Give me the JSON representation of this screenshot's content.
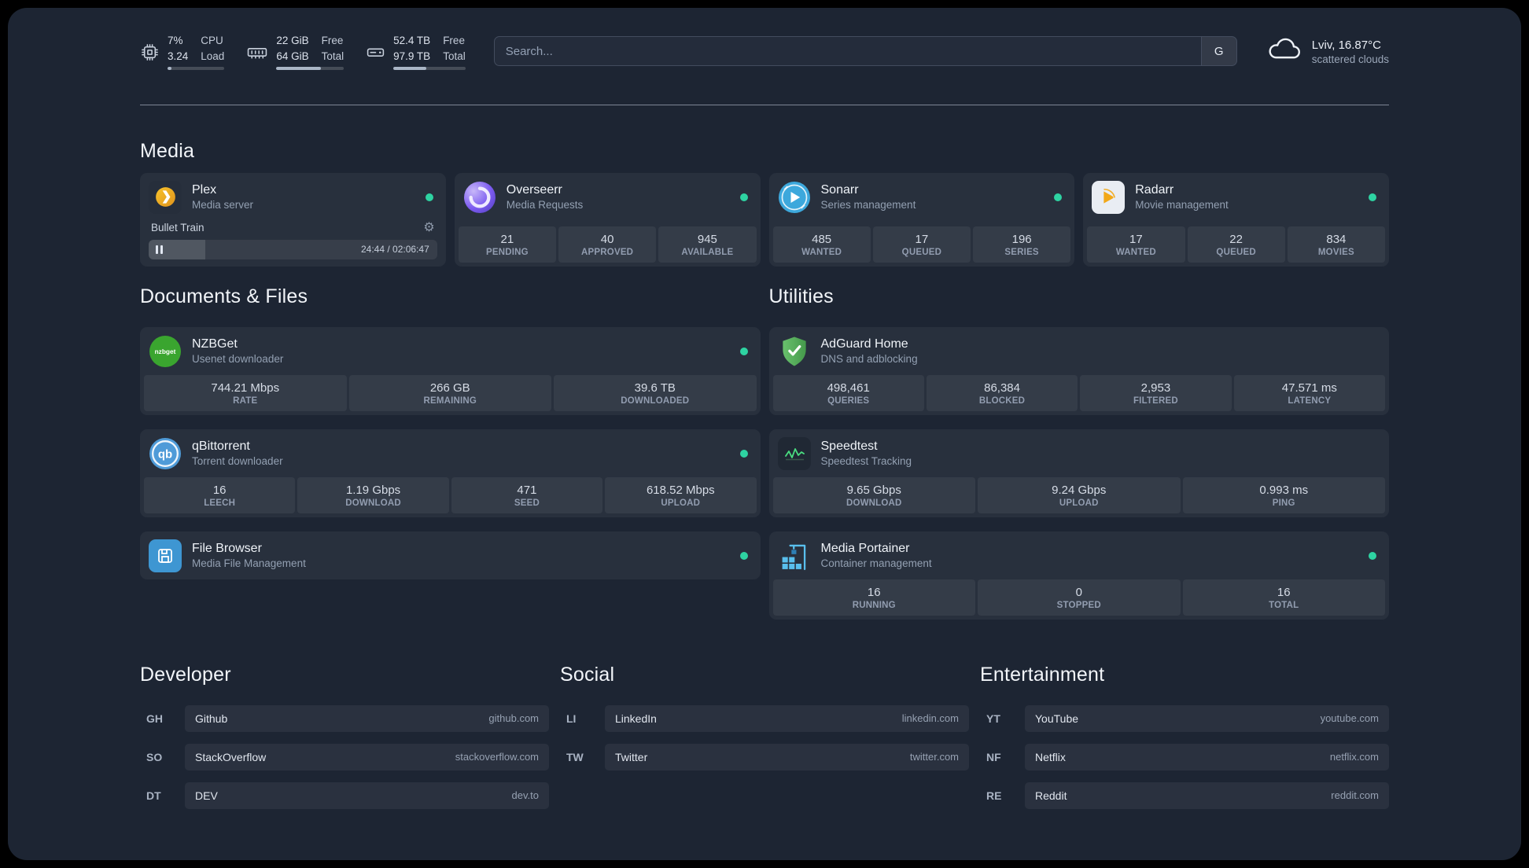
{
  "topbar": {
    "resources": [
      {
        "widget": "cpu",
        "value_top": "7%",
        "value_bottom": "3.24",
        "label_top": "CPU",
        "label_bottom": "Load",
        "percent": 7
      },
      {
        "widget": "memory",
        "value_top": "22 GiB",
        "value_bottom": "64 GiB",
        "label_top": "Free",
        "label_bottom": "Total",
        "percent": 66
      },
      {
        "widget": "disk",
        "value_top": "52.4 TB",
        "value_bottom": "97.9 TB",
        "label_top": "Free",
        "label_bottom": "Total",
        "percent": 46
      }
    ],
    "search": {
      "placeholder": "Search...",
      "provider_button": "G"
    },
    "weather": {
      "location": "Lviv, 16.87°C",
      "condition": "scattered clouds"
    }
  },
  "icons": {
    "gear": "⚙"
  },
  "media": {
    "title": "Media",
    "plex": {
      "name": "Plex",
      "subtitle": "Media server",
      "player": {
        "title": "Bullet Train",
        "time": "24:44 / 02:06:47",
        "progress": 19.5
      }
    },
    "overseerr": {
      "name": "Overseerr",
      "subtitle": "Media Requests",
      "stats": [
        {
          "value": "21",
          "label": "PENDING"
        },
        {
          "value": "40",
          "label": "APPROVED"
        },
        {
          "value": "945",
          "label": "AVAILABLE"
        }
      ]
    },
    "sonarr": {
      "name": "Sonarr",
      "subtitle": "Series management",
      "stats": [
        {
          "value": "485",
          "label": "WANTED"
        },
        {
          "value": "17",
          "label": "QUEUED"
        },
        {
          "value": "196",
          "label": "SERIES"
        }
      ]
    },
    "radarr": {
      "name": "Radarr",
      "subtitle": "Movie management",
      "stats": [
        {
          "value": "17",
          "label": "WANTED"
        },
        {
          "value": "22",
          "label": "QUEUED"
        },
        {
          "value": "834",
          "label": "MOVIES"
        }
      ]
    }
  },
  "documents": {
    "title": "Documents & Files",
    "nzbget": {
      "name": "NZBGet",
      "subtitle": "Usenet downloader",
      "stats": [
        {
          "value": "744.21 Mbps",
          "label": "RATE"
        },
        {
          "value": "266 GB",
          "label": "REMAINING"
        },
        {
          "value": "39.6 TB",
          "label": "DOWNLOADED"
        }
      ]
    },
    "qbittorrent": {
      "name": "qBittorrent",
      "subtitle": "Torrent downloader",
      "stats": [
        {
          "value": "16",
          "label": "LEECH"
        },
        {
          "value": "1.19 Gbps",
          "label": "DOWNLOAD"
        },
        {
          "value": "471",
          "label": "SEED"
        },
        {
          "value": "618.52 Mbps",
          "label": "UPLOAD"
        }
      ]
    },
    "filebrowser": {
      "name": "File Browser",
      "subtitle": "Media File Management"
    }
  },
  "utilities": {
    "title": "Utilities",
    "adguard": {
      "name": "AdGuard Home",
      "subtitle": "DNS and adblocking",
      "stats": [
        {
          "value": "498,461",
          "label": "QUERIES"
        },
        {
          "value": "86,384",
          "label": "BLOCKED"
        },
        {
          "value": "2,953",
          "label": "FILTERED"
        },
        {
          "value": "47.571 ms",
          "label": "LATENCY"
        }
      ]
    },
    "speedtest": {
      "name": "Speedtest",
      "subtitle": "Speedtest Tracking",
      "stats": [
        {
          "value": "9.65 Gbps",
          "label": "DOWNLOAD"
        },
        {
          "value": "9.24 Gbps",
          "label": "UPLOAD"
        },
        {
          "value": "0.993 ms",
          "label": "PING"
        }
      ]
    },
    "portainer": {
      "name": "Media Portainer",
      "subtitle": "Container management",
      "stats": [
        {
          "value": "16",
          "label": "RUNNING"
        },
        {
          "value": "0",
          "label": "STOPPED"
        },
        {
          "value": "16",
          "label": "TOTAL"
        }
      ]
    }
  },
  "bookmarks": {
    "developer": {
      "title": "Developer",
      "items": [
        {
          "abbr": "GH",
          "name": "Github",
          "url": "github.com"
        },
        {
          "abbr": "SO",
          "name": "StackOverflow",
          "url": "stackoverflow.com"
        },
        {
          "abbr": "DT",
          "name": "DEV",
          "url": "dev.to"
        }
      ]
    },
    "social": {
      "title": "Social",
      "items": [
        {
          "abbr": "LI",
          "name": "LinkedIn",
          "url": "linkedin.com"
        },
        {
          "abbr": "TW",
          "name": "Twitter",
          "url": "twitter.com"
        }
      ]
    },
    "entertainment": {
      "title": "Entertainment",
      "items": [
        {
          "abbr": "YT",
          "name": "YouTube",
          "url": "youtube.com"
        },
        {
          "abbr": "NF",
          "name": "Netflix",
          "url": "netflix.com"
        },
        {
          "abbr": "RE",
          "name": "Reddit",
          "url": "reddit.com"
        }
      ]
    }
  },
  "colors": {
    "status_online": "#2ed3a2",
    "page_background": "#1d2533",
    "sparkline_green": "#4ade80"
  }
}
